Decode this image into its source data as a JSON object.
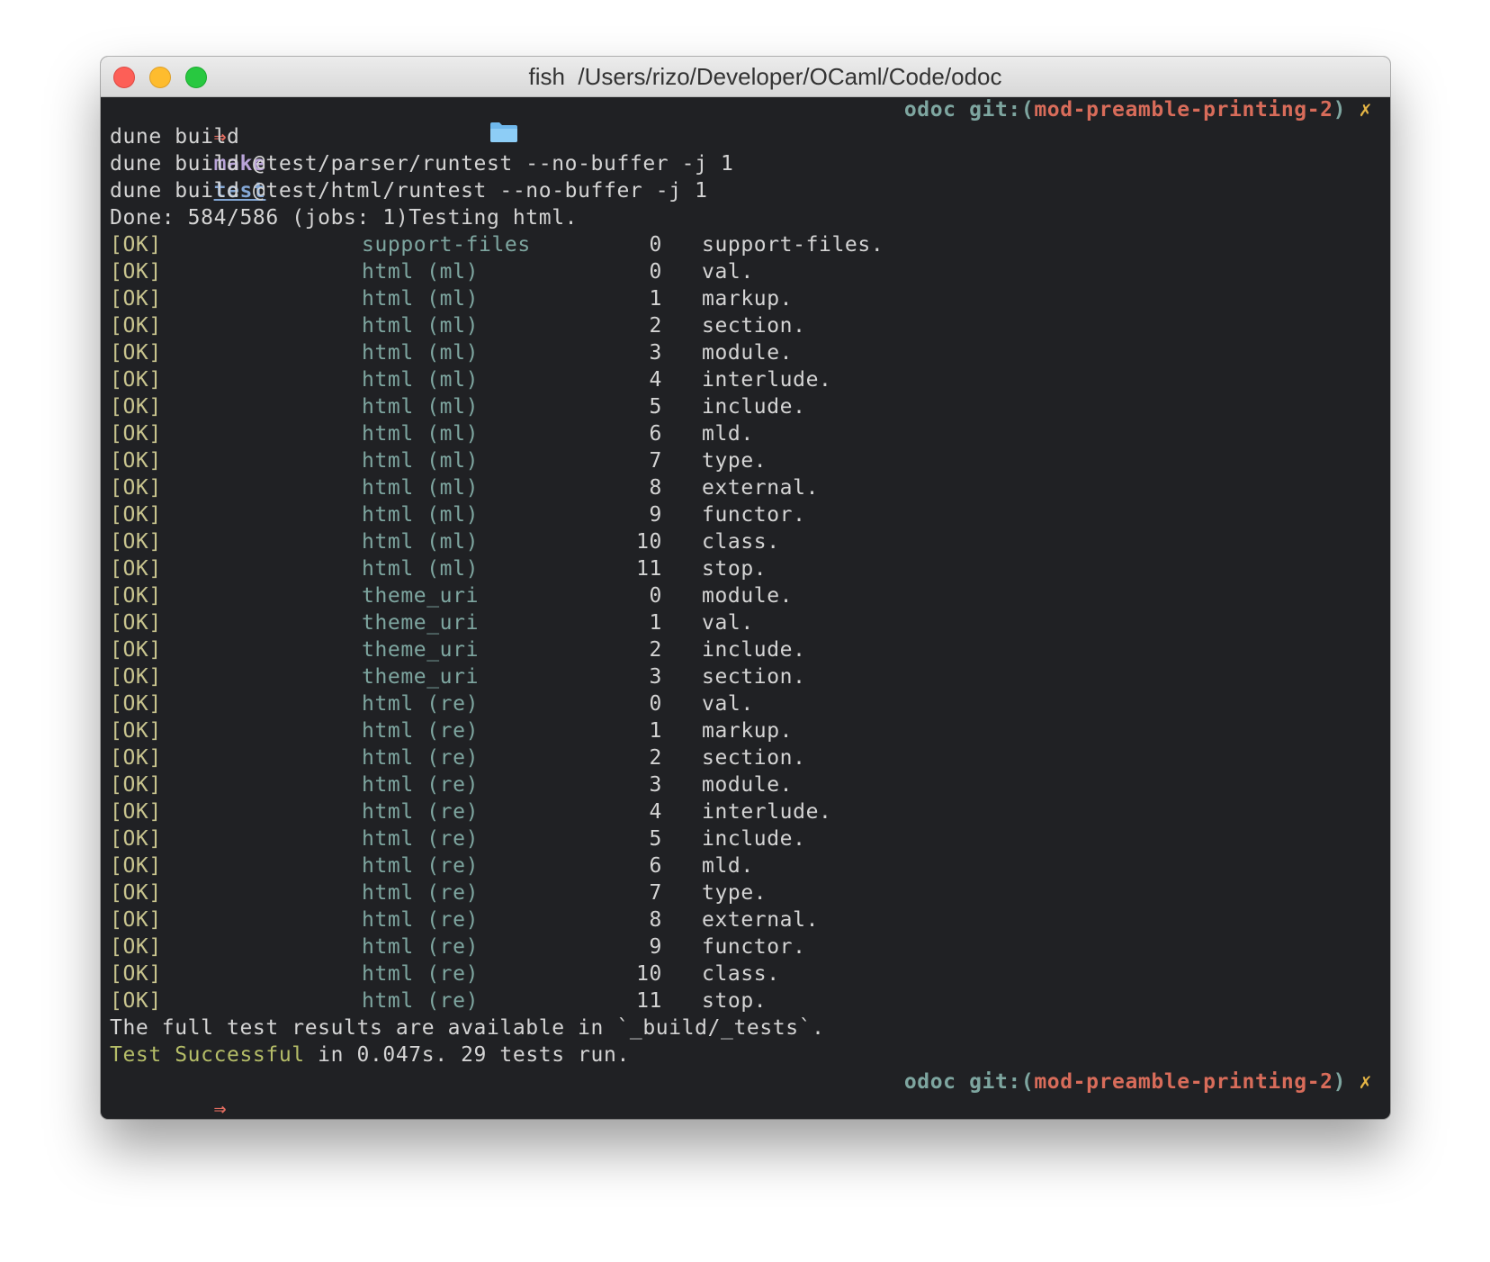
{
  "window": {
    "title_shell": "fish",
    "title_path": "/Users/rizo/Developer/OCaml/Code/odoc",
    "icons": {
      "close": "close-icon",
      "minimize": "minimize-icon",
      "zoom": "zoom-icon",
      "folder": "folder-icon"
    }
  },
  "colors": {
    "background": "#202124",
    "ok": "#c8c48e",
    "name": "#7ea6a0",
    "branch": "#d86c5a",
    "arrow": "#e06c5f",
    "dirty": "#e5b545"
  },
  "prompt": {
    "arrow": "⇒",
    "command": "make",
    "arg": "test",
    "dir": "odoc",
    "git": "git:(",
    "branch": "mod-preamble-printing-2",
    "git_close": ")",
    "dirty_mark": "✗"
  },
  "output": {
    "lines": [
      "dune build",
      "dune build @test/parser/runtest --no-buffer -j 1",
      "dune build @test/html/runtest --no-buffer -j 1",
      "Done: 584/586 (jobs: 1)Testing html."
    ]
  },
  "results": [
    {
      "status": "[OK]",
      "suite": "support-files",
      "num": "0",
      "desc": "support-files."
    },
    {
      "status": "[OK]",
      "suite": "html (ml)",
      "num": "0",
      "desc": "val."
    },
    {
      "status": "[OK]",
      "suite": "html (ml)",
      "num": "1",
      "desc": "markup."
    },
    {
      "status": "[OK]",
      "suite": "html (ml)",
      "num": "2",
      "desc": "section."
    },
    {
      "status": "[OK]",
      "suite": "html (ml)",
      "num": "3",
      "desc": "module."
    },
    {
      "status": "[OK]",
      "suite": "html (ml)",
      "num": "4",
      "desc": "interlude."
    },
    {
      "status": "[OK]",
      "suite": "html (ml)",
      "num": "5",
      "desc": "include."
    },
    {
      "status": "[OK]",
      "suite": "html (ml)",
      "num": "6",
      "desc": "mld."
    },
    {
      "status": "[OK]",
      "suite": "html (ml)",
      "num": "7",
      "desc": "type."
    },
    {
      "status": "[OK]",
      "suite": "html (ml)",
      "num": "8",
      "desc": "external."
    },
    {
      "status": "[OK]",
      "suite": "html (ml)",
      "num": "9",
      "desc": "functor."
    },
    {
      "status": "[OK]",
      "suite": "html (ml)",
      "num": "10",
      "desc": "class."
    },
    {
      "status": "[OK]",
      "suite": "html (ml)",
      "num": "11",
      "desc": "stop."
    },
    {
      "status": "[OK]",
      "suite": "theme_uri",
      "num": "0",
      "desc": "module."
    },
    {
      "status": "[OK]",
      "suite": "theme_uri",
      "num": "1",
      "desc": "val."
    },
    {
      "status": "[OK]",
      "suite": "theme_uri",
      "num": "2",
      "desc": "include."
    },
    {
      "status": "[OK]",
      "suite": "theme_uri",
      "num": "3",
      "desc": "section."
    },
    {
      "status": "[OK]",
      "suite": "html (re)",
      "num": "0",
      "desc": "val."
    },
    {
      "status": "[OK]",
      "suite": "html (re)",
      "num": "1",
      "desc": "markup."
    },
    {
      "status": "[OK]",
      "suite": "html (re)",
      "num": "2",
      "desc": "section."
    },
    {
      "status": "[OK]",
      "suite": "html (re)",
      "num": "3",
      "desc": "module."
    },
    {
      "status": "[OK]",
      "suite": "html (re)",
      "num": "4",
      "desc": "interlude."
    },
    {
      "status": "[OK]",
      "suite": "html (re)",
      "num": "5",
      "desc": "include."
    },
    {
      "status": "[OK]",
      "suite": "html (re)",
      "num": "6",
      "desc": "mld."
    },
    {
      "status": "[OK]",
      "suite": "html (re)",
      "num": "7",
      "desc": "type."
    },
    {
      "status": "[OK]",
      "suite": "html (re)",
      "num": "8",
      "desc": "external."
    },
    {
      "status": "[OK]",
      "suite": "html (re)",
      "num": "9",
      "desc": "functor."
    },
    {
      "status": "[OK]",
      "suite": "html (re)",
      "num": "10",
      "desc": "class."
    },
    {
      "status": "[OK]",
      "suite": "html (re)",
      "num": "11",
      "desc": "stop."
    }
  ],
  "summary": {
    "results_line": "The full test results are available in `_build/_tests`.",
    "success_label": "Test Successful",
    "success_rest": " in 0.047s. 29 tests run."
  }
}
